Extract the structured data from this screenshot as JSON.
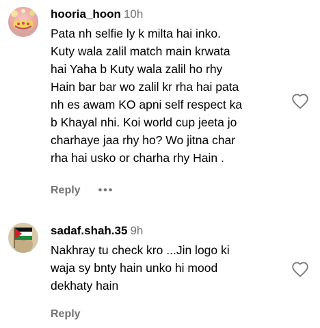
{
  "comments": [
    {
      "username": "hooria_hoon",
      "time": "10h",
      "lines": [
        "Pata nh selfie ly k milta hai inko.",
        "Kuty wala zalil match main krwata",
        "hai Yaha b Kuty wala zalil ho rhy",
        "Hain bar bar wo zalil kr rha hai pata",
        "nh es awam KO apni self respect ka",
        "b Khayal nhi. Koi world cup jeeta jo",
        "charhaye jaa rhy ho? Wo jitna char",
        "rha hai usko or charha rhy Hain ."
      ],
      "reply_label": "Reply",
      "more_label": "•••",
      "avatar_icon": "profile-photo-icon",
      "like_icon": "heart-outline-icon"
    },
    {
      "username": "sadaf.shah.35",
      "time": "9h",
      "lines": [
        "Nakhray tu check kro ...Jin logo ki",
        "waja sy bnty hain unko hi mood",
        "dekhaty hain"
      ],
      "reply_label": "Reply",
      "avatar_icon": "palestine-flag-avatar-icon",
      "like_icon": "heart-outline-icon"
    }
  ],
  "colors": {
    "text": "#000000",
    "secondary": "#737373",
    "background": "#ffffff"
  }
}
